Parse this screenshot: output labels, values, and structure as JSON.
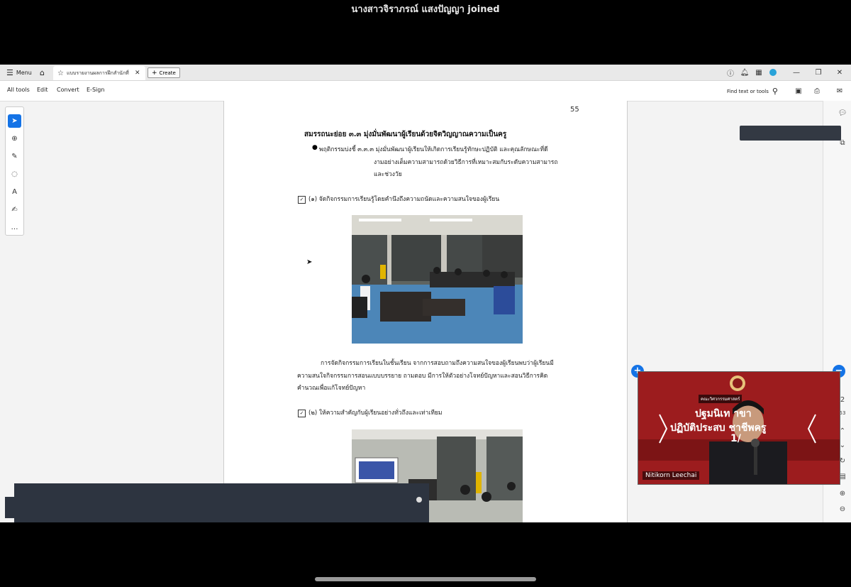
{
  "notification": "นางสาวจิราภรณ์ แสงปัญญา joined",
  "tabbar": {
    "menu_label": "Menu",
    "tab_title": "แบบรายงานผลการฝึกสำนักที่ 3...",
    "create_label": "Create"
  },
  "toolbar": {
    "items": [
      "All tools",
      "Edit",
      "Convert",
      "E-Sign"
    ],
    "find_label": "Find text or tools"
  },
  "document": {
    "page_number": "55",
    "heading": "สมรรถนะย่อย ๓.๓ มุ่งมั่นพัฒนาผู้เรียนด้วยจิตวิญญาณความเป็นครู",
    "bullet_line1": "พฤติกรรมบ่งชี้ ๓.๓.๓ มุ่งมั่นพัฒนาผู้เรียนให้เกิดการเรียนรู้ทักษะปฏิบัติ และคุณลักษณะที่ดี",
    "bullet_line2": "งามอย่างเต็มความสามารถด้วยวิธีการที่เหมาะสมกับระดับความสามารถ",
    "bullet_line3": "และช่วงวัย",
    "check1": "(๑) จัดกิจกรรมการเรียนรู้โดยคำนึงถึงความถนัดและความสนใจของผู้เรียน",
    "para_line1": "การจัดกิจกรรมการเรียนในชั้นเรียน จากการสอบถามถึงความสนใจของผู้เรียนพบว่าผู้เรียนมี",
    "para_line2": "ความสนใจกิจกรรมการสอนแบบบรรยาย ถามตอบ มีการให้ตัวอย่างโจทย์ปัญหาและสอนวิธีการคิด",
    "para_line3": "คำนวณเพื่อแก้โจทย์ปัญหา",
    "check2": "(๒) ให้ความสำคัญกับผู้เรียนอย่างทั่วถึงและเท่าเทียม"
  },
  "video": {
    "participant_name": "Nitikorn Leechai",
    "banner_small": "คณะวิศวกรรมศาสตร์",
    "banner_line1": "ปฐมนิเท          าขา",
    "banner_line2": "ปฏิบัติประสบ        ชาชีพครู",
    "banner_line3": "1/"
  },
  "right_rail_fragments": [
    "2",
    "53"
  ]
}
